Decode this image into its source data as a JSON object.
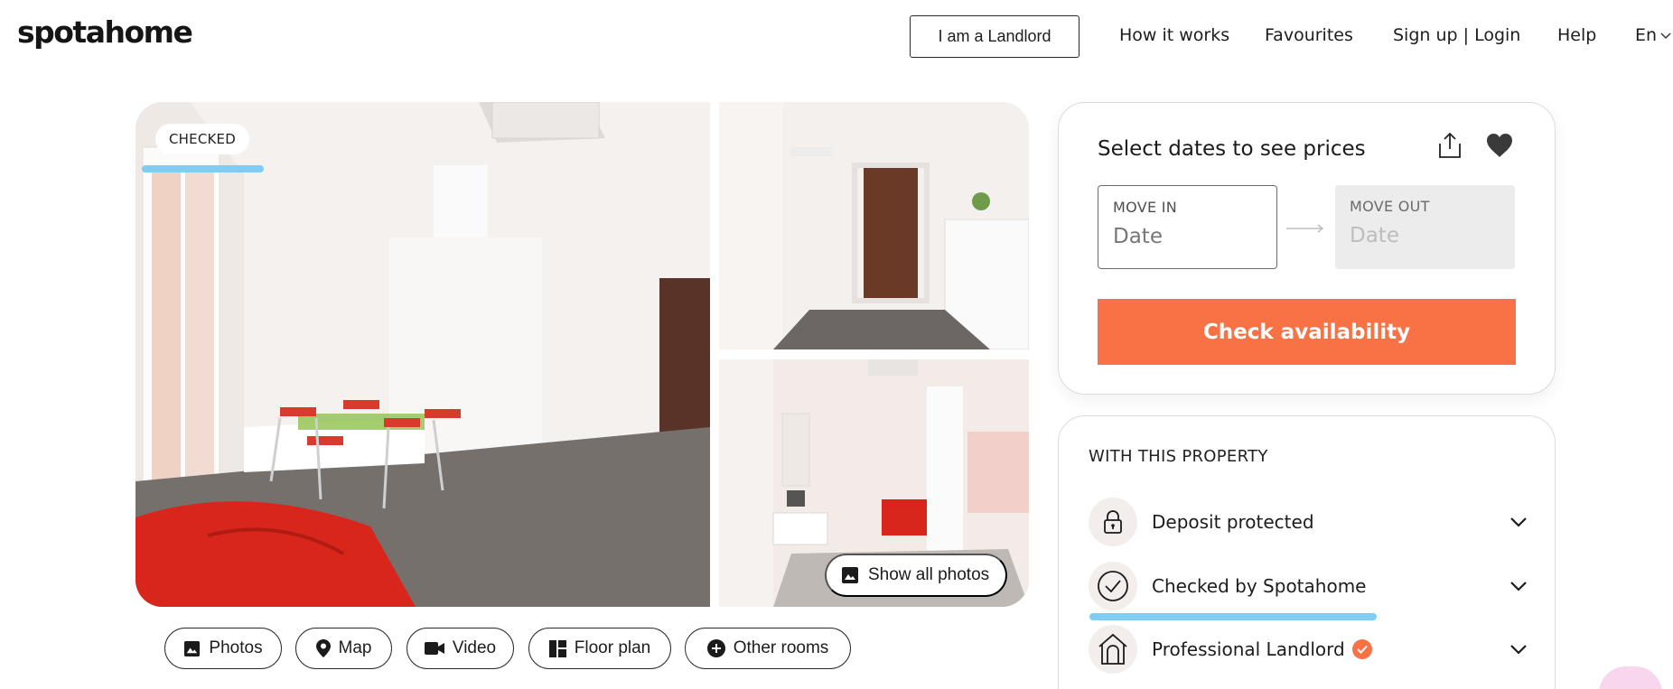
{
  "header": {
    "logo": "spotahome",
    "landlord_button": "I am a Landlord",
    "nav": {
      "how_it_works": "How it works",
      "favourites": "Favourites",
      "sign_up_login": "Sign up | Login",
      "help": "Help",
      "language": "En"
    }
  },
  "gallery": {
    "badge": "CHECKED",
    "show_all_photos": "Show all photos",
    "tabs": {
      "photos": "Photos",
      "map": "Map",
      "video": "Video",
      "floor_plan": "Floor plan",
      "other_rooms": "Other rooms"
    }
  },
  "booking": {
    "title": "Select dates to see prices",
    "move_in_label": "MOVE IN",
    "move_in_placeholder": "Date",
    "move_out_label": "MOVE OUT",
    "move_out_placeholder": "Date",
    "check_button": "Check availability",
    "accent_color": "#f97245"
  },
  "features": {
    "title": "WITH THIS PROPERTY",
    "items": [
      {
        "label": "Deposit protected",
        "icon": "lock-icon"
      },
      {
        "label": "Checked by Spotahome",
        "icon": "check-circle-icon"
      },
      {
        "label": "Professional Landlord",
        "icon": "house-icon",
        "verified": true
      }
    ]
  }
}
